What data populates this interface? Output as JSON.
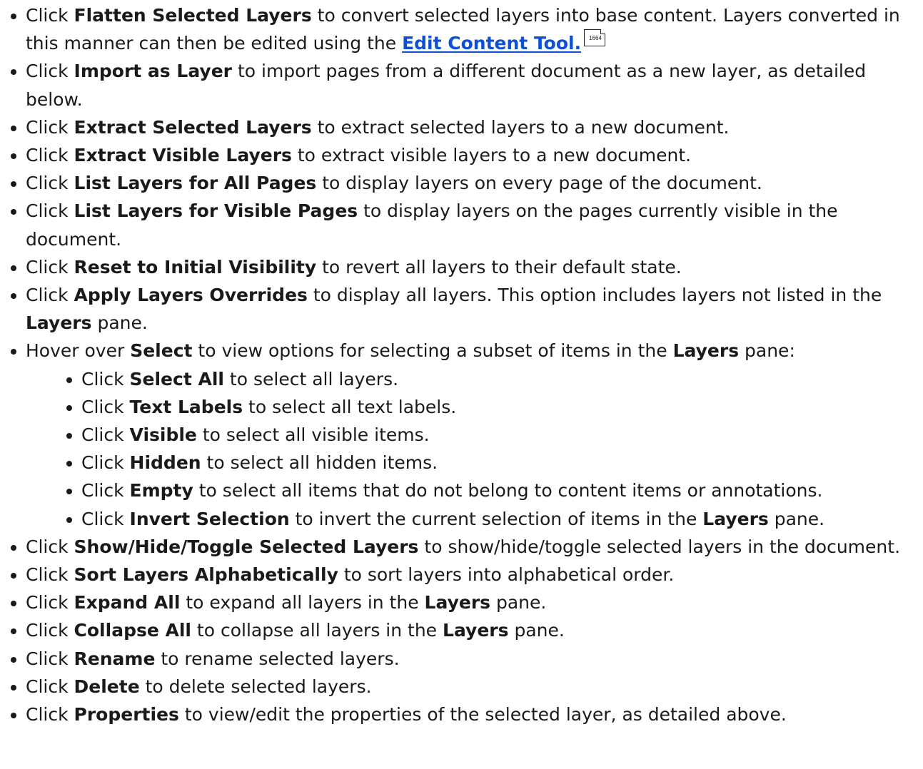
{
  "items": [
    {
      "pre": "Click ",
      "bold": "Flatten Selected Layers",
      "post": " to convert selected layers into base content. Layers converted in this manner can then be edited using the ",
      "link": "Edit Content Tool.",
      "page_ref": "1664"
    },
    {
      "pre": "Click ",
      "bold": "Import as Layer",
      "post": " to import pages from a different document as a new layer, as detailed below."
    },
    {
      "pre": "Click ",
      "bold": "Extract Selected Layers",
      "post": " to extract selected layers to a new document."
    },
    {
      "pre": "Click ",
      "bold": "Extract Visible Layers",
      "post": " to extract visible layers to a new document."
    },
    {
      "pre": "Click ",
      "bold": "List Layers for All Pages",
      "post": " to display layers on every page of the document."
    },
    {
      "pre": "Click ",
      "bold": "List Layers for Visible Pages",
      "post": " to display layers on the pages currently visible in the document."
    },
    {
      "pre": "Click ",
      "bold": "Reset to Initial Visibility",
      "post": " to revert all layers to their default state."
    },
    {
      "pre": "Click ",
      "bold": "Apply Layers Overrides",
      "post": " to display all layers. This option includes layers not listed in the ",
      "bold2": "Layers",
      "post2": " pane."
    },
    {
      "pre": "Hover over ",
      "bold": "Select",
      "post": " to view options for selecting a subset of items in the ",
      "bold2": "Layers",
      "post2": " pane:"
    },
    {
      "pre": "Click ",
      "bold": "Show/Hide/Toggle Selected Layers",
      "post": " to show/hide/toggle selected layers in the document."
    },
    {
      "pre": "Click ",
      "bold": "Sort Layers Alphabetically",
      "post": " to sort layers into alphabetical order."
    },
    {
      "pre": "Click ",
      "bold": "Expand All",
      "post": " to expand all layers in the ",
      "bold2": "Layers",
      "post2": " pane."
    },
    {
      "pre": "Click ",
      "bold": "Collapse All",
      "post": " to collapse all layers in the ",
      "bold2": "Layers",
      "post2": " pane."
    },
    {
      "pre": "Click ",
      "bold": "Rename",
      "post": " to rename selected layers."
    },
    {
      "pre": "Click ",
      "bold": "Delete",
      "post": " to delete selected layers."
    },
    {
      "pre": "Click ",
      "bold": "Properties",
      "post": " to view/edit the properties of the selected layer, as detailed above."
    }
  ],
  "select_subitems": [
    {
      "pre": "Click ",
      "bold": "Select All",
      "post": " to select all layers."
    },
    {
      "pre": "Click ",
      "bold": "Text Labels",
      "post": " to select all text labels."
    },
    {
      "pre": "Click ",
      "bold": "Visible",
      "post": " to select all visible items."
    },
    {
      "pre": "Click ",
      "bold": "Hidden",
      "post": " to select all hidden items."
    },
    {
      "pre": "Click ",
      "bold": "Empty",
      "post": " to select all items that do not belong to content items or annotations."
    },
    {
      "pre": "Click ",
      "bold": "Invert Selection",
      "post": " to invert the current selection of items in the ",
      "bold2": "Layers",
      "post2": " pane."
    }
  ]
}
